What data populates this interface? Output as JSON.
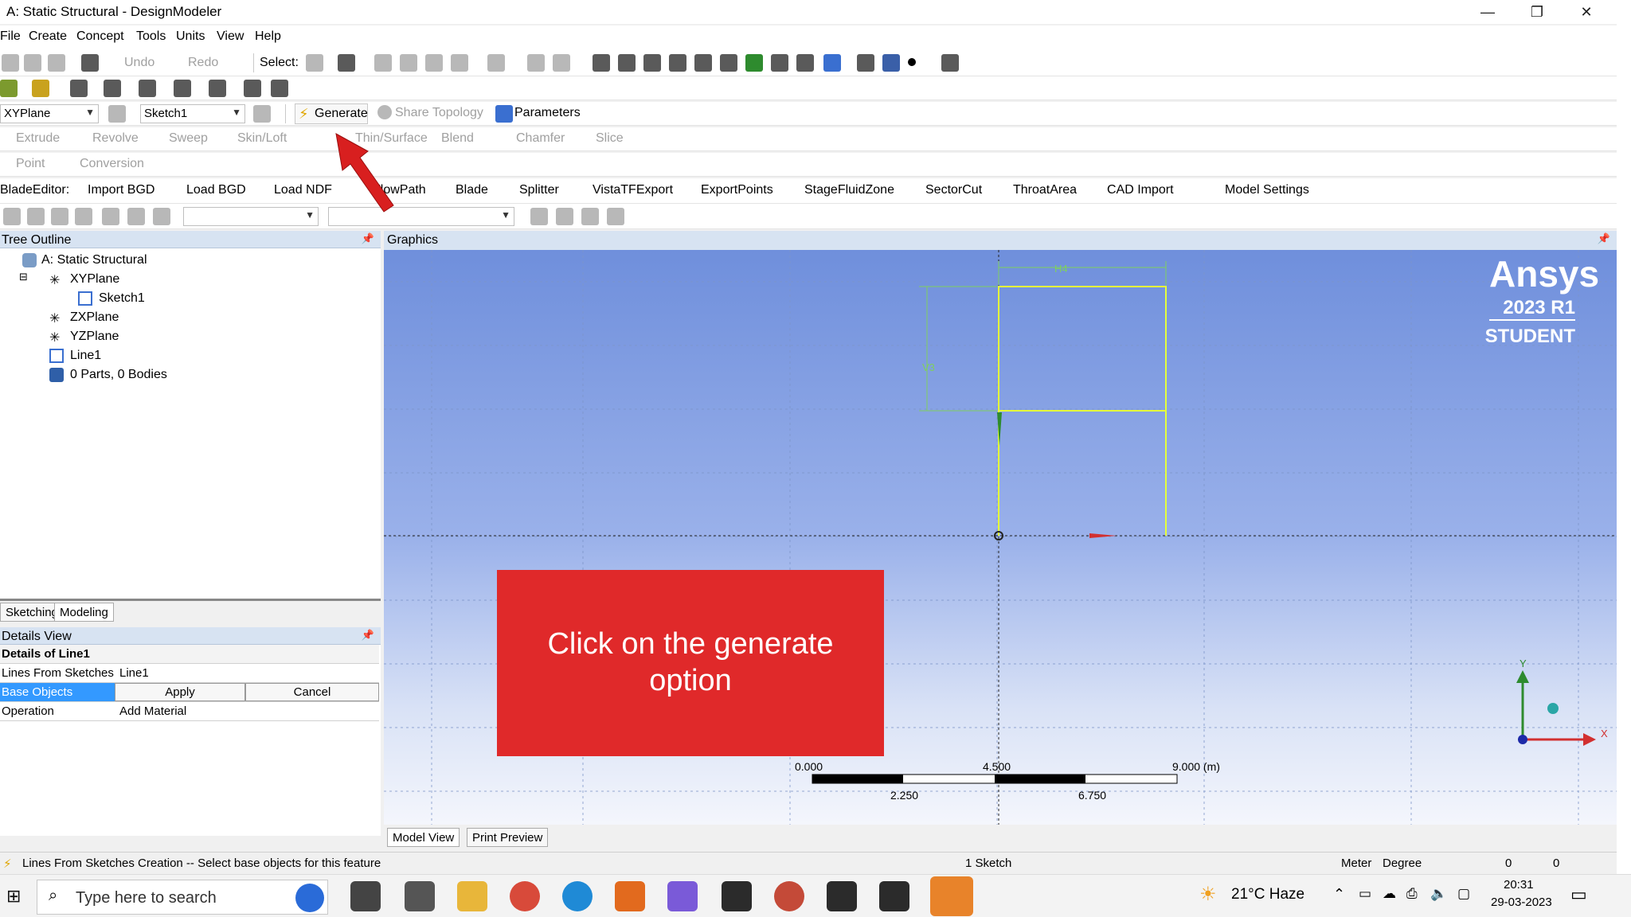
{
  "window": {
    "title": "A: Static Structural - DesignModeler",
    "minimize": "—",
    "restore": "❐",
    "close": "✕"
  },
  "menu": [
    "File",
    "Create",
    "Concept",
    "Tools",
    "Units",
    "View",
    "Help"
  ],
  "toolbar1": {
    "undo": "Undo",
    "redo": "Redo",
    "select": "Select:"
  },
  "toolbar3": {
    "plane": "XYPlane",
    "sketch": "Sketch1",
    "generate": "Generate",
    "share_topology": "Share Topology",
    "parameters": "Parameters"
  },
  "toolbar4": [
    "Extrude",
    "Revolve",
    "Sweep",
    "Skin/Loft",
    "Thin/Surface",
    "Blend",
    "Chamfer",
    "Slice"
  ],
  "toolbar5": [
    "Point",
    "Conversion"
  ],
  "toolbar6": {
    "prefix": "BladeEditor:",
    "items": [
      "Import BGD",
      "Load BGD",
      "Load NDF",
      "FlowPath",
      "Blade",
      "Splitter",
      "VistaTFExport",
      "ExportPoints",
      "StageFluidZone",
      "SectorCut",
      "ThroatArea",
      "CAD Import",
      "Model Settings"
    ]
  },
  "tree": {
    "header": "Tree Outline",
    "root": "A: Static Structural",
    "items": [
      {
        "label": "XYPlane"
      },
      {
        "label": "Sketch1"
      },
      {
        "label": "ZXPlane"
      },
      {
        "label": "YZPlane"
      },
      {
        "label": "Line1"
      },
      {
        "label": "0 Parts, 0 Bodies"
      }
    ]
  },
  "mode_tabs": {
    "sketching": "Sketching",
    "modeling": "Modeling"
  },
  "details": {
    "header": "Details View",
    "title": "Details of Line1",
    "rows": [
      {
        "label": "Lines From Sketches",
        "value": "Line1"
      },
      {
        "label": "Base Objects",
        "apply": "Apply",
        "cancel": "Cancel"
      },
      {
        "label": "Operation",
        "value": "Add Material"
      }
    ]
  },
  "graphics": {
    "header": "Graphics",
    "brand": "Ansys",
    "version": "2023 R1",
    "edition": "STUDENT",
    "dim_h": "H4",
    "dim_v": "V3",
    "scale_labels": [
      "0.000",
      "4.500",
      "9.000 (m)",
      "2.250",
      "6.750"
    ],
    "axis_x": "X",
    "axis_y": "Y",
    "colors": {
      "sketch": "#e5ff3a",
      "dim": "#7fcf5f",
      "callout": "#e0292a"
    }
  },
  "callout": {
    "line1": "Click on the generate",
    "line2": "option"
  },
  "view_tabs": {
    "model": "Model View",
    "print": "Print Preview"
  },
  "status": {
    "message": "Lines From Sketches Creation -- Select base objects for this feature",
    "sketch_count": "1 Sketch",
    "unit_length": "Meter",
    "unit_angle": "Degree",
    "val1": "0",
    "val2": "0"
  },
  "taskbar": {
    "search_placeholder": "Type here to search",
    "weather": "21°C  Haze",
    "time": "20:31",
    "date": "29-03-2023",
    "apps": [
      "task-view",
      "mail",
      "file-explorer",
      "chrome",
      "edge",
      "matlab",
      "app",
      "workbench",
      "chrome-profile",
      "workbench",
      "designmodeler",
      "spaceclaim"
    ]
  }
}
